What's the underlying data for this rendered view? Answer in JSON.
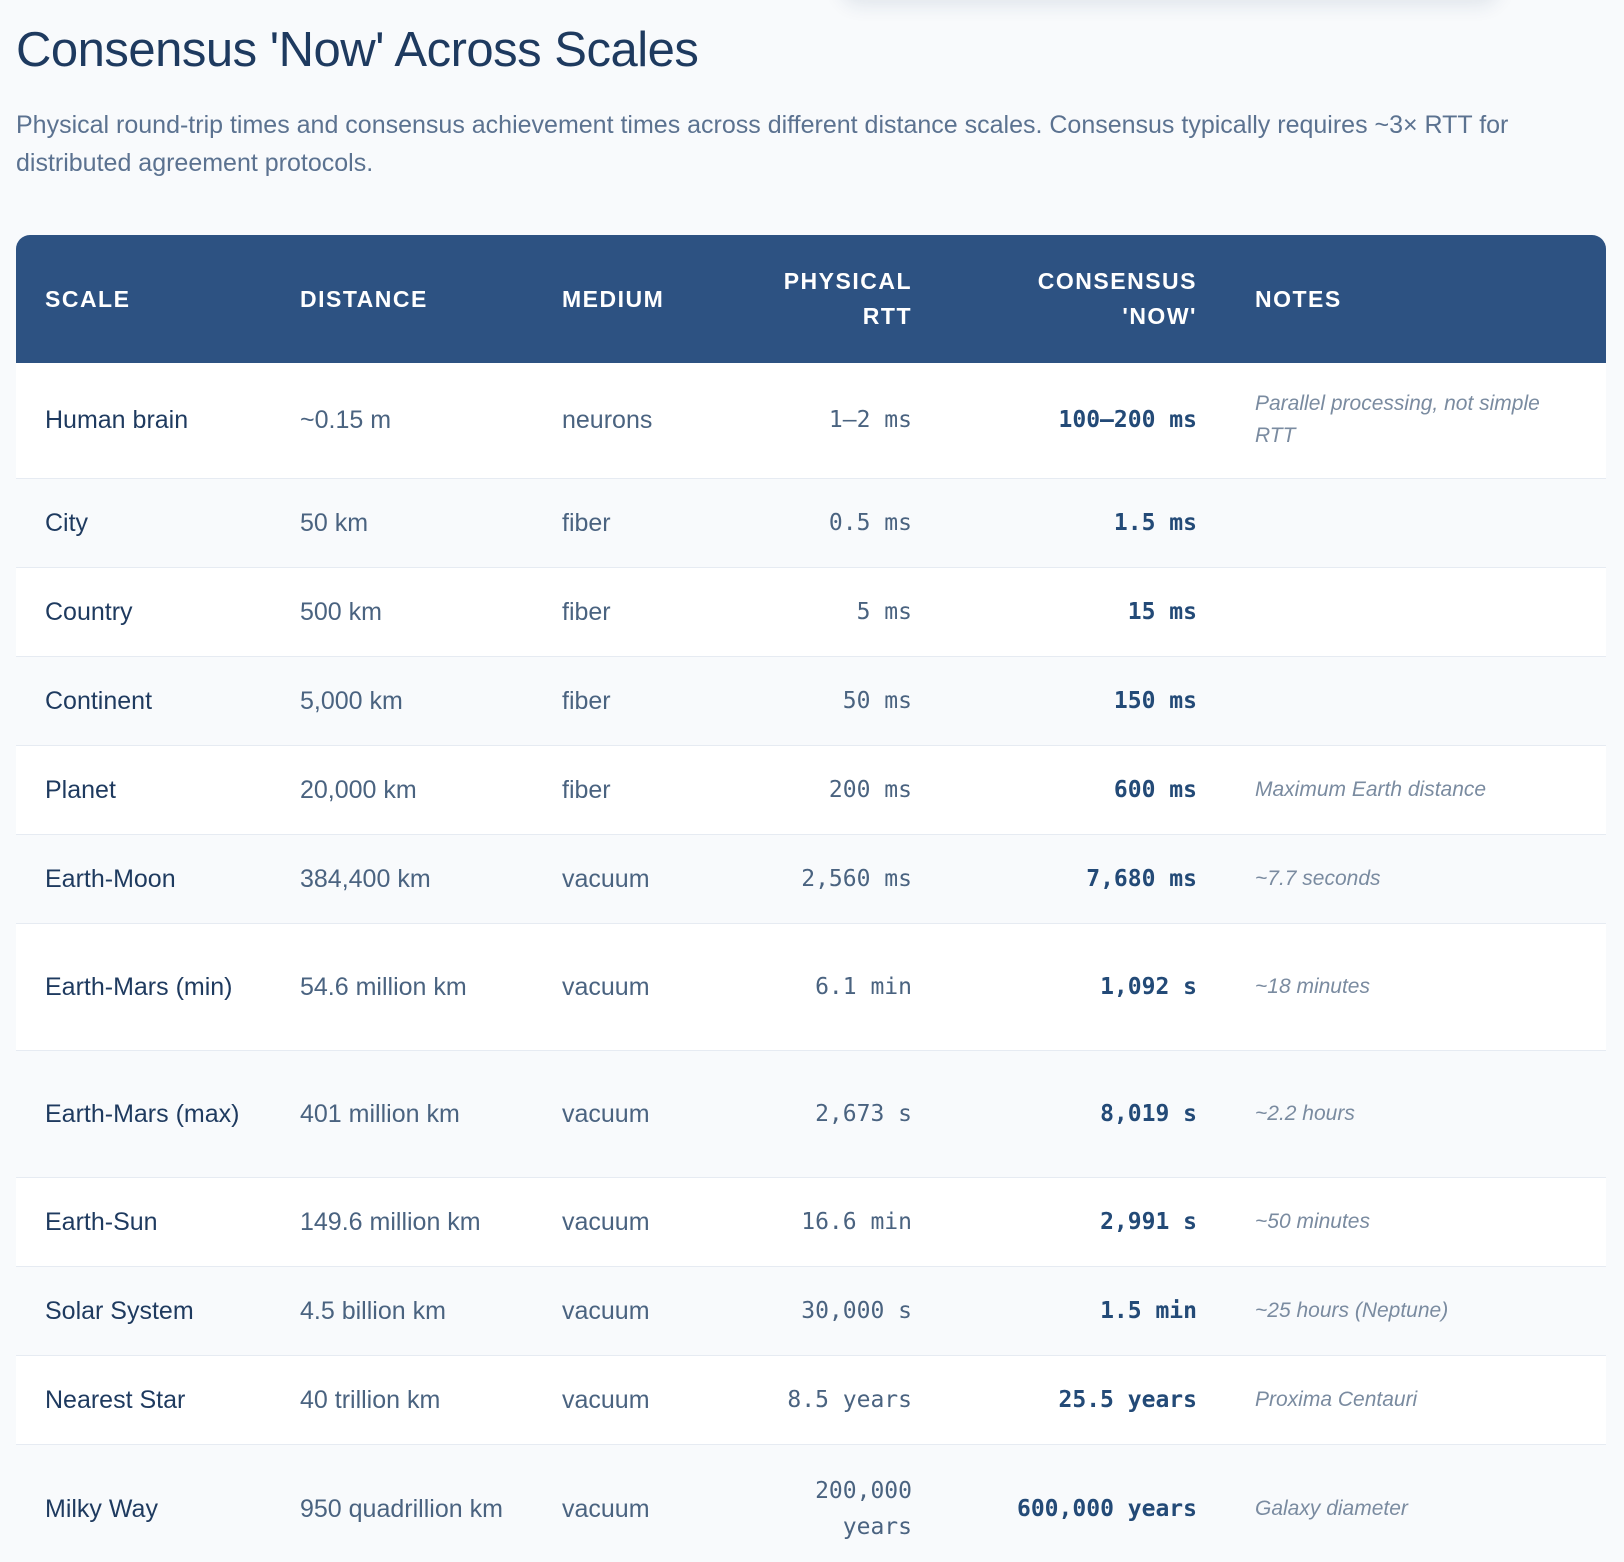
{
  "title": "Consensus 'Now' Across Scales",
  "subtitle": "Physical round-trip times and consensus achievement times across different distance scales. Consensus typically requires ~3× RTT for distributed agreement protocols.",
  "table": {
    "headers": {
      "scale": "SCALE",
      "distance": "DISTANCE",
      "medium": "MEDIUM",
      "physical_rtt_line1": "PHYSICAL",
      "physical_rtt_line2": "RTT",
      "consensus_line1": "CONSENSUS",
      "consensus_line2": "'NOW'",
      "notes": "NOTES"
    },
    "rows": [
      {
        "scale": "Human brain",
        "distance": "~0.15 m",
        "medium": "neurons",
        "rtt": "1–2 ms",
        "consensus": "100–200 ms",
        "notes": "Parallel processing, not simple RTT"
      },
      {
        "scale": "City",
        "distance": "50 km",
        "medium": "fiber",
        "rtt": "0.5 ms",
        "consensus": "1.5 ms",
        "notes": ""
      },
      {
        "scale": "Country",
        "distance": "500 km",
        "medium": "fiber",
        "rtt": "5 ms",
        "consensus": "15 ms",
        "notes": ""
      },
      {
        "scale": "Continent",
        "distance": "5,000 km",
        "medium": "fiber",
        "rtt": "50 ms",
        "consensus": "150 ms",
        "notes": ""
      },
      {
        "scale": "Planet",
        "distance": "20,000 km",
        "medium": "fiber",
        "rtt": "200 ms",
        "consensus": "600 ms",
        "notes": "Maximum Earth distance"
      },
      {
        "scale": "Earth-Moon",
        "distance": "384,400 km",
        "medium": "vacuum",
        "rtt": "2,560 ms",
        "consensus": "7,680 ms",
        "notes": "~7.7 seconds"
      },
      {
        "scale": "Earth-Mars (min)",
        "distance": "54.6 million km",
        "medium": "vacuum",
        "rtt": "6.1 min",
        "consensus": "1,092 s",
        "notes": "~18 minutes"
      },
      {
        "scale": "Earth-Mars (max)",
        "distance": "401 million km",
        "medium": "vacuum",
        "rtt": "2,673 s",
        "consensus": "8,019 s",
        "notes": "~2.2 hours"
      },
      {
        "scale": "Earth-Sun",
        "distance": "149.6 million km",
        "medium": "vacuum",
        "rtt": "16.6 min",
        "consensus": "2,991 s",
        "notes": "~50 minutes"
      },
      {
        "scale": "Solar System",
        "distance": "4.5 billion km",
        "medium": "vacuum",
        "rtt": "30,000 s",
        "consensus": "1.5 min",
        "notes": "~25 hours (Neptune)"
      },
      {
        "scale": "Nearest Star",
        "distance": "40 trillion km",
        "medium": "vacuum",
        "rtt": "8.5 years",
        "consensus": "25.5 years",
        "notes": "Proxima Centauri"
      },
      {
        "scale": "Milky Way",
        "distance": "950 quadrillion km",
        "medium": "vacuum",
        "rtt": "200,000 years",
        "consensus": "600,000 years",
        "notes": "Galaxy diameter"
      }
    ]
  }
}
